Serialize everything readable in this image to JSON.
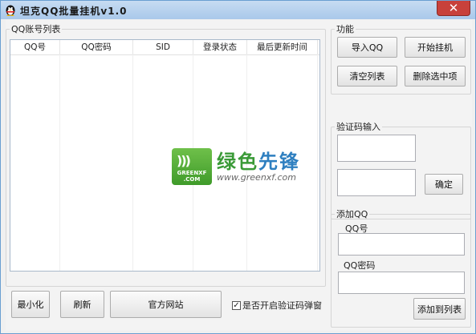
{
  "window": {
    "title": "坦克QQ批量挂机v1.0",
    "close_glyph": "✕"
  },
  "account_list": {
    "group_label": "QQ账号列表",
    "columns": [
      "QQ号",
      "QQ密码",
      "SID",
      "登录状态",
      "最后更新时间"
    ]
  },
  "functions": {
    "group_label": "功能",
    "import_label": "导入QQ",
    "start_label": "开始挂机",
    "clear_label": "清空列表",
    "delete_label": "删除选中项"
  },
  "captcha": {
    "group_label": "验证码输入",
    "confirm_label": "确定"
  },
  "add_qq": {
    "group_label": "添加QQ",
    "qq_label": "QQ号",
    "qq_value": "",
    "password_label": "QQ密码",
    "password_value": "",
    "add_label": "添加到列表"
  },
  "bottom": {
    "minimize_label": "最小化",
    "refresh_label": "刷新",
    "website_label": "官方网站",
    "popup_checkbox_label": "是否开启验证码弹窗",
    "popup_checked": true,
    "check_glyph": "✓"
  },
  "watermark": {
    "logo_text_line1": "GREENXF",
    "logo_text_line2": ".COM",
    "cn_green": "绿色",
    "cn_blue": "先锋",
    "url": "www.greenxf.com"
  }
}
